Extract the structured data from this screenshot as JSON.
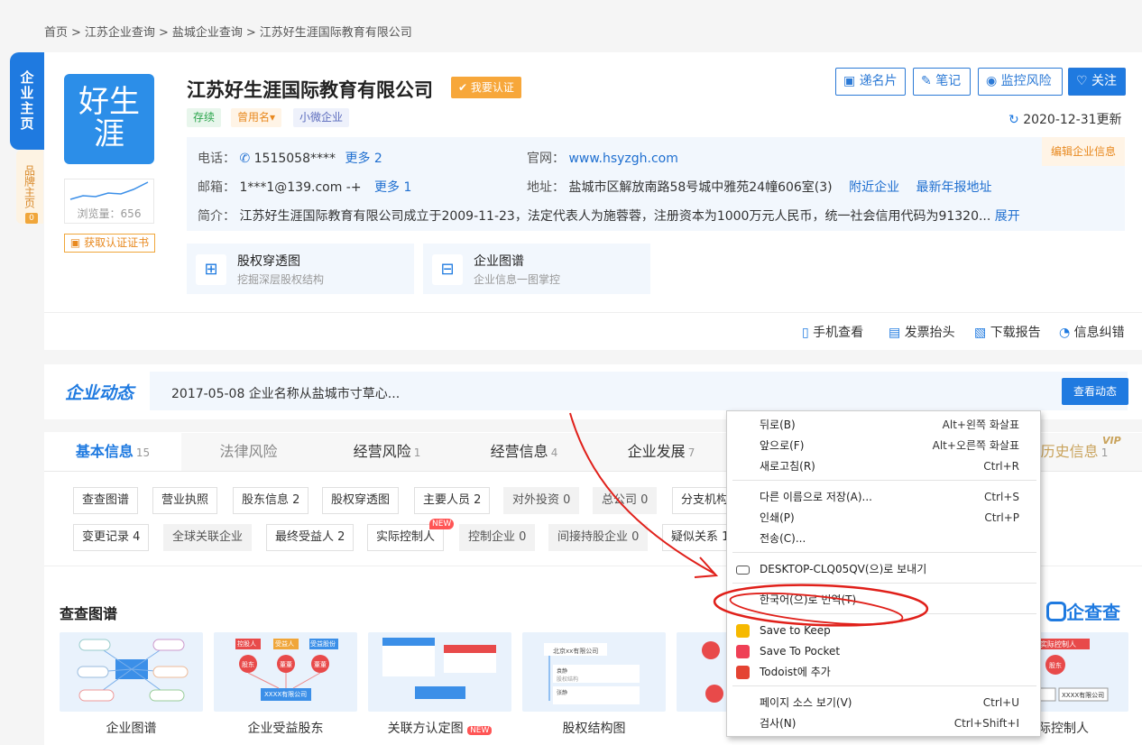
{
  "breadcrumb": [
    "首页",
    ">",
    "江苏企业查询",
    ">",
    "盐城企业查询",
    ">",
    "江苏好生涯国际教育有限公司"
  ],
  "side_tabs": {
    "main": "企业主页",
    "brand": "品牌主页",
    "brand_count": "0"
  },
  "logo": {
    "line1": "好生",
    "line2": "涯"
  },
  "views": "浏览量：656",
  "cert_link": "获取认证证书",
  "company": {
    "name": "江苏好生涯国际教育有限公司",
    "verify": "我要认证",
    "tags": [
      "存续",
      "曾用名",
      "小微企业"
    ],
    "update_date": "2020-12-31更新"
  },
  "header_buttons": [
    "递名片",
    "笔记",
    "监控风险",
    "关注"
  ],
  "info": {
    "phone_label": "电话：",
    "phone": "1515058****",
    "phone_more": "更多 2",
    "web_label": "官网：",
    "web": "www.hsyzgh.com",
    "email_label": "邮箱：",
    "email": "1***1@139.com -+",
    "email_more": "更多 1",
    "addr_label": "地址：",
    "addr": "盐城市区解放南路58号城中雅苑24幢606室(3)",
    "addr_link1": "附近企业",
    "addr_link2": "最新年报地址",
    "intro_label": "简介：",
    "intro": "江苏好生涯国际教育有限公司成立于2009-11-23，法定代表人为施蓉蓉，注册资本为1000万元人民币，统一社会信用代码为91320...",
    "intro_more": "展开",
    "edit": "编辑企业信息"
  },
  "features": [
    {
      "title": "股权穿透图",
      "sub": "挖掘深层股权结构"
    },
    {
      "title": "企业图谱",
      "sub": "企业信息一图掌控"
    }
  ],
  "tools": [
    "手机查看",
    "发票抬头",
    "下载报告",
    "信息纠错"
  ],
  "news": {
    "title": "企业动态",
    "text": "2017-05-08 企业名称从盐城市寸草心...",
    "button": "查看动态"
  },
  "tabs": [
    {
      "label": "基本信息",
      "count": "15"
    },
    {
      "label": "法律风险",
      "count": ""
    },
    {
      "label": "经营风险",
      "count": "1"
    },
    {
      "label": "经营信息",
      "count": "4"
    },
    {
      "label": "企业发展",
      "count": "7"
    },
    {
      "label": "历史信息",
      "count": "1"
    }
  ],
  "vip": "VIP",
  "chips_row1": [
    "查查图谱",
    "营业执照",
    "股东信息 2",
    "股权穿透图",
    "主要人员 2",
    "对外投资 0",
    "总公司 0",
    "分支机构"
  ],
  "chips_row2": [
    "变更记录 4",
    "全球关联企业",
    "最终受益人 2",
    "实际控制人",
    "控制企业 0",
    "间接持股企业 0",
    "疑似关系 1"
  ],
  "new_badge": "NEW",
  "section_title": "查查图谱",
  "qcc": "企查查",
  "thumbs": [
    "企业图谱",
    "企业受益股东",
    "关联方认定图",
    "股权结构图",
    "",
    "际控制人"
  ],
  "thumb_texts": {
    "t2": [
      "控股人",
      "受益人",
      "受益股份",
      "股东",
      "董董",
      "董董",
      "XXXX有限公司"
    ],
    "t4": [
      "北京xx有限公司",
      "袁静",
      "股权结构",
      "张静"
    ],
    "t6": [
      "实际控制人",
      "股东",
      "XXXX有限公司"
    ]
  },
  "context_menu": [
    {
      "label": "뒤로(B)",
      "shortcut": "Alt+왼쪽 화살표"
    },
    {
      "label": "앞으로(F)",
      "shortcut": "Alt+오른쪽 화살표"
    },
    {
      "label": "새로고침(R)",
      "shortcut": "Ctrl+R"
    },
    {
      "label": "다른 이름으로 저장(A)...",
      "shortcut": "Ctrl+S"
    },
    {
      "label": "인쇄(P)",
      "shortcut": "Ctrl+P"
    },
    {
      "label": "전송(C)...",
      "shortcut": ""
    },
    {
      "label": "DESKTOP-CLQ05QV(으)로 보내기",
      "shortcut": ""
    },
    {
      "label": "한국어(으)로 번역(T)",
      "shortcut": ""
    },
    {
      "label": "Save to Keep",
      "shortcut": ""
    },
    {
      "label": "Save To Pocket",
      "shortcut": ""
    },
    {
      "label": "Todoist에 추가",
      "shortcut": ""
    },
    {
      "label": "페이지 소스 보기(V)",
      "shortcut": "Ctrl+U"
    },
    {
      "label": "검사(N)",
      "shortcut": "Ctrl+Shift+I"
    }
  ],
  "colors": {
    "accent": "#1f7ae0",
    "orange": "#f7a73a",
    "annotation": "#e0201a"
  }
}
